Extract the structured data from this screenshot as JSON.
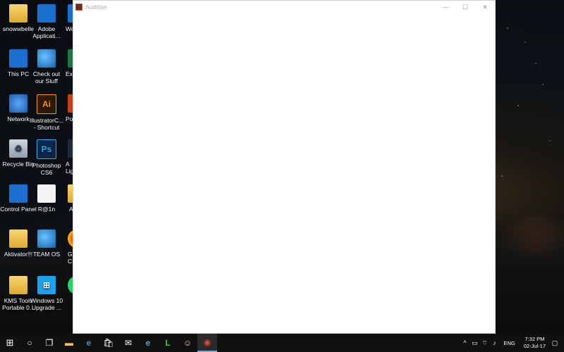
{
  "desktop": {
    "icons": [
      {
        "label": "snowwbelle",
        "glyph": ""
      },
      {
        "label": "Adobe Applicati...",
        "glyph": ""
      },
      {
        "label": "Wo",
        "glyph": "W"
      },
      {
        "label": "This PC",
        "glyph": ""
      },
      {
        "label": "Check out our Stuff",
        "glyph": ""
      },
      {
        "label": "Exc",
        "glyph": "X"
      },
      {
        "label": "Network",
        "glyph": ""
      },
      {
        "label": "IllustratorC... - Shortcut",
        "glyph": "Ai"
      },
      {
        "label": "Pow",
        "glyph": "P"
      },
      {
        "label": "Recycle Bin",
        "glyph": "♻"
      },
      {
        "label": "Photoshop CS6",
        "glyph": "Ps"
      },
      {
        "label": "A Lig",
        "glyph": ""
      },
      {
        "label": "Control Panel",
        "glyph": ""
      },
      {
        "label": "R@1n",
        "glyph": ""
      },
      {
        "label": "A",
        "glyph": ""
      },
      {
        "label": "Aktivator!!!",
        "glyph": ""
      },
      {
        "label": "TEAM OS",
        "glyph": ""
      },
      {
        "label": "G C",
        "glyph": ""
      },
      {
        "label": "KMS Tools Portable 0...",
        "glyph": ""
      },
      {
        "label": "Windows 10 Upgrade ...",
        "glyph": "⊞"
      }
    ]
  },
  "window": {
    "title": "Audition",
    "minimize": "—",
    "maximize": "☐",
    "close": "✕"
  },
  "taskbar": {
    "start": "⊞",
    "search": "○",
    "taskview": "❐",
    "apps": [
      {
        "name": "file-explorer",
        "glyph": "▬"
      },
      {
        "name": "edge",
        "glyph": "e"
      },
      {
        "name": "store",
        "glyph": "🛍"
      },
      {
        "name": "mail",
        "glyph": "✉"
      },
      {
        "name": "internet-explorer",
        "glyph": "e"
      },
      {
        "name": "line",
        "glyph": "L"
      },
      {
        "name": "game-app",
        "glyph": "☺"
      },
      {
        "name": "audition",
        "glyph": "◉"
      }
    ],
    "tray": {
      "chevron": "^",
      "battery": "▭",
      "wifi": "⌔",
      "volume": "♪",
      "language": "ENG",
      "time": "7:32 PM",
      "date": "02-Jul-17",
      "notifications": "▢"
    }
  }
}
